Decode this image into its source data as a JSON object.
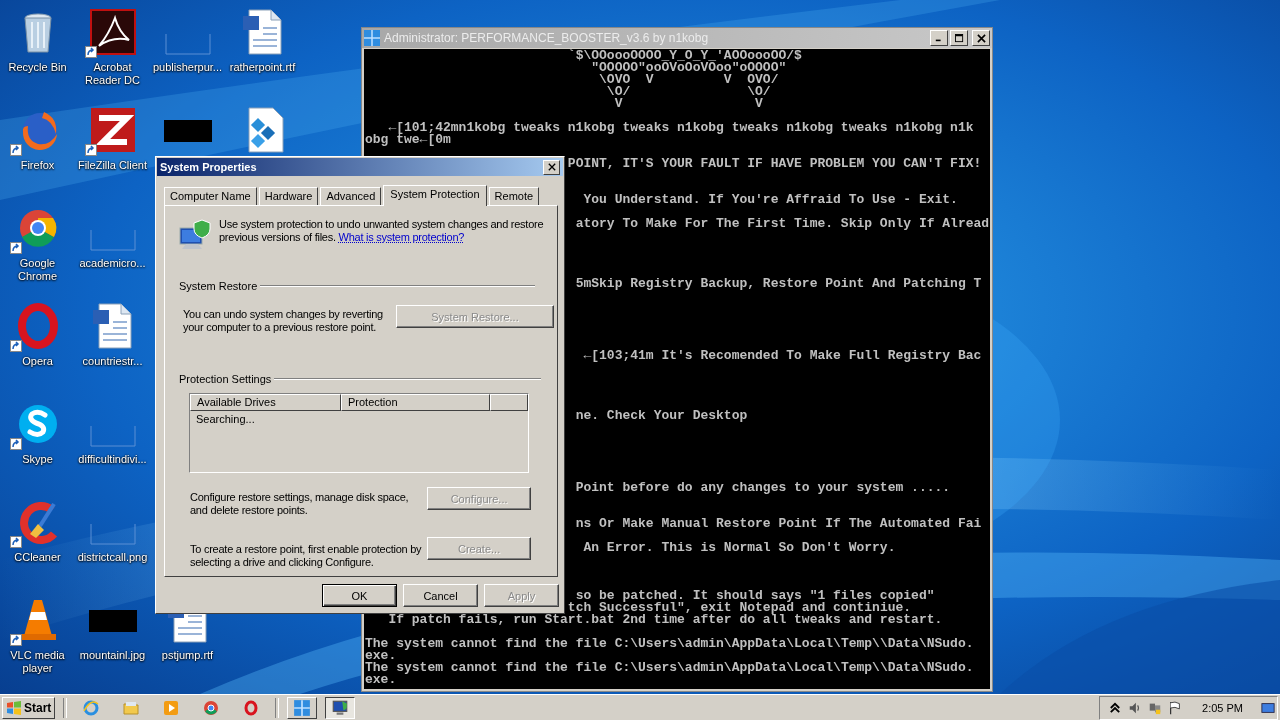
{
  "desktop_icons": [
    {
      "label": "Recycle Bin",
      "kind": "recycle",
      "shortcut": false
    },
    {
      "label": "Firefox",
      "kind": "firefox",
      "shortcut": true
    },
    {
      "label": "Google Chrome",
      "kind": "chrome",
      "shortcut": true
    },
    {
      "label": "Opera",
      "kind": "opera",
      "shortcut": true
    },
    {
      "label": "Skype",
      "kind": "skype",
      "shortcut": true
    },
    {
      "label": "CCleaner",
      "kind": "ccleaner",
      "shortcut": true
    },
    {
      "label": "VLC media player",
      "kind": "vlc",
      "shortcut": true
    },
    {
      "label": "Acrobat Reader DC",
      "kind": "acrobat",
      "shortcut": true
    },
    {
      "label": "FileZilla Client",
      "kind": "filezilla",
      "shortcut": true
    },
    {
      "label": "academicro...",
      "kind": "blank",
      "shortcut": false
    },
    {
      "label": "countriestr...",
      "kind": "word",
      "shortcut": false
    },
    {
      "label": "difficultindivi...",
      "kind": "blank",
      "shortcut": false
    },
    {
      "label": "districtcall.png",
      "kind": "blank",
      "shortcut": false
    },
    {
      "label": "mountainl.jpg",
      "kind": "dark",
      "shortcut": false
    },
    {
      "label": "publisherpur...",
      "kind": "blank",
      "shortcut": false
    },
    {
      "kind": "dark",
      "shortcut": false
    },
    {
      "label": "pstjump.rtf",
      "kind": "word",
      "shortcut": false
    },
    {
      "label": "ratherpoint.rtf",
      "kind": "word",
      "shortcut": false
    },
    {
      "kind": "registry",
      "shortcut": false
    }
  ],
  "console": {
    "title": "Administrator:  PERFORMANCE_BOOSTER_v3.6 by n1kobg",
    "lines": [
      {
        "text": "`$\\OOoooOOOO_Y_O_Y_'AOOoooOO/$"
      },
      {
        "text": "\"OOOOO\"ooOVoOoVOoo\"oOOOO\""
      },
      {
        "text": "\\OVO  V         V  OVO/"
      },
      {
        "text": "\\O/               \\O/"
      },
      {
        "text": "V                 V"
      },
      {
        "text": "←[101;42mn1kobg tweaks n1kobg tweaks n1kobg tweaks n1kobg tweaks n1kobg n1k"
      },
      {
        "text": "obg twe←[0m"
      },
      {
        "text": "POINT, IT'S YOUR FAULT IF HAVE PROBLEM YOU CAN'T FIX!"
      },
      {
        "text": "You Understand. If You're Affraid To Use - Exit."
      },
      {
        "text": "atory To Make For The First Time. Skip Only If Alread"
      },
      {
        "text": "5mSkip Registry Backup, Restore Point And Patching T"
      },
      {
        "text": "←[103;41m It's Recomended To Make Full Registry Bac"
      },
      {
        "text": "ne. Check Your Desktop"
      },
      {
        "text": "Point before do any changes to your system ....."
      },
      {
        "text": "ns Or Make Manual Restore Point If The Automated Fai"
      },
      {
        "text": "An Error. This is Normal So Don't Worry."
      },
      {
        "text": "so be patched. It should says \"1 files copied\""
      },
      {
        "text": "tch Successful\", exit Notepad and continiue."
      },
      {
        "text": "If patch fails, run Start.bat 2nd time after do all tweaks and restart."
      },
      {
        "text": "The system cannot find the file C:\\Users\\admin\\AppData\\Local\\Temp\\\\Data\\NSudo."
      },
      {
        "text": "exe."
      },
      {
        "text": "The system cannot find the file C:\\Users\\admin\\AppData\\Local\\Temp\\\\Data\\NSudo."
      },
      {
        "text": "exe."
      }
    ]
  },
  "dialog": {
    "title": "System Properties",
    "tabs": [
      {
        "label": "Computer Name",
        "selected": false
      },
      {
        "label": "Hardware",
        "selected": false
      },
      {
        "label": "Advanced",
        "selected": false
      },
      {
        "label": "System Protection",
        "selected": true
      },
      {
        "label": "Remote",
        "selected": false
      }
    ],
    "intro": {
      "text": "Use system protection to undo unwanted system changes and restore previous versions of files.",
      "link": "What is system protection?"
    },
    "system_restore": {
      "heading": "System Restore",
      "text": "You can undo system changes by reverting your computer to a previous restore point.",
      "button": {
        "label": "System Restore...",
        "disabled": true
      }
    },
    "protection_settings": {
      "heading": "Protection Settings",
      "columns": [
        "Available Drives",
        "Protection"
      ],
      "status": "Searching...",
      "configure": {
        "text": "Configure restore settings, manage disk space, and delete restore points.",
        "button": {
          "label": "Configure...",
          "disabled": true
        }
      },
      "create": {
        "text": "To create a restore point, first enable protection by selecting a drive and clicking Configure.",
        "button": {
          "label": "Create...",
          "disabled": true
        }
      }
    },
    "buttons": [
      {
        "label": "OK",
        "default": true,
        "disabled": false
      },
      {
        "label": "Cancel",
        "default": false,
        "disabled": false
      },
      {
        "label": "Apply",
        "default": false,
        "disabled": true
      }
    ]
  },
  "taskbar": {
    "start": "Start",
    "tasks": [
      {
        "selected": false
      },
      {
        "selected": true
      }
    ],
    "clock": "2:05 PM"
  }
}
